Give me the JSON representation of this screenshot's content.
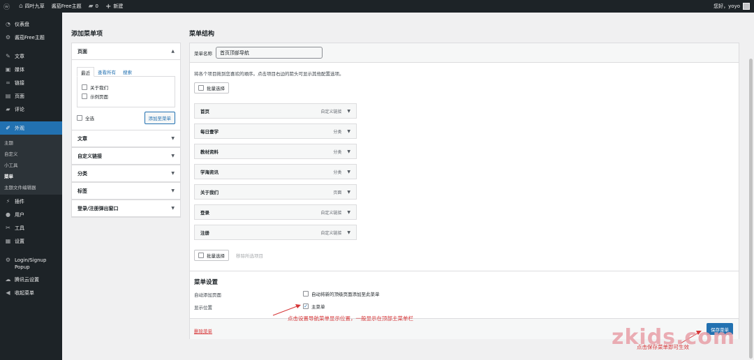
{
  "adminbar": {
    "site_name": "四叶九草",
    "theme": "酱茄Free主题",
    "comments": "0",
    "new": "新建",
    "greeting": "您好，yoyo"
  },
  "sidebar": {
    "items": [
      {
        "label": "仪表盘",
        "icon": "dashboard-icon"
      },
      {
        "label": "酱茄Free主题",
        "icon": "gear-icon"
      },
      {
        "label": "文章",
        "icon": "pin-icon"
      },
      {
        "label": "媒体",
        "icon": "media-icon"
      },
      {
        "label": "链接",
        "icon": "link-icon"
      },
      {
        "label": "页面",
        "icon": "page-icon"
      },
      {
        "label": "评论",
        "icon": "comment-icon"
      },
      {
        "label": "外观",
        "icon": "brush-icon"
      }
    ],
    "submenu": [
      "主题",
      "自定义",
      "小工具",
      "菜单",
      "主题文件编辑器"
    ],
    "items2": [
      {
        "label": "插件",
        "icon": "plugin-icon"
      },
      {
        "label": "用户",
        "icon": "user-icon"
      },
      {
        "label": "工具",
        "icon": "wrench-icon"
      },
      {
        "label": "设置",
        "icon": "settings-icon"
      }
    ],
    "items3": [
      {
        "label": "Login/Signup Popup",
        "icon": "gear-icon"
      },
      {
        "label": "腾讯云设置",
        "icon": "cloud-icon"
      },
      {
        "label": "收起菜单",
        "icon": "collapse-icon"
      }
    ]
  },
  "add_items": {
    "title": "添加菜单项",
    "pages": {
      "header": "页面",
      "tabs": [
        "最近",
        "查看所有",
        "搜索"
      ],
      "items": [
        "关于我们",
        "示例页面"
      ],
      "select_all": "全选",
      "add_button": "添加至菜单"
    },
    "sections": [
      "文章",
      "自定义链接",
      "分类",
      "标签",
      "登录/注册弹出窗口"
    ]
  },
  "menu_structure": {
    "title": "菜单结构",
    "name_label": "菜单名称",
    "name_value": "首页顶部导航",
    "instructions": "将各个项目拖到您喜欢的顺序。点击项目右边的箭头可显示其他配置选项。",
    "bulk_select": "批量选择",
    "remove_selected": "移除所选项目",
    "items": [
      {
        "title": "首页",
        "type": "自定义链接"
      },
      {
        "title": "每日壹学",
        "type": "分类"
      },
      {
        "title": "教材资料",
        "type": "分类"
      },
      {
        "title": "学海资讯",
        "type": "分类"
      },
      {
        "title": "关于我们",
        "type": "页面"
      },
      {
        "title": "登录",
        "type": "自定义链接"
      },
      {
        "title": "注册",
        "type": "自定义链接"
      }
    ]
  },
  "menu_settings": {
    "title": "菜单设置",
    "auto_add_label": "自动添加页面",
    "auto_add_option": "自动将新的顶级页面添加至此菜单",
    "display_label": "显示位置",
    "display_option": "主菜单"
  },
  "footer": {
    "delete": "删除菜单",
    "save": "保存菜单"
  },
  "annotations": {
    "location_note": "点击设置导航菜单显示位置，一般显示在顶部主菜单栏",
    "save_note": "点击保存菜单即可生效"
  },
  "watermark": "zkids.com"
}
